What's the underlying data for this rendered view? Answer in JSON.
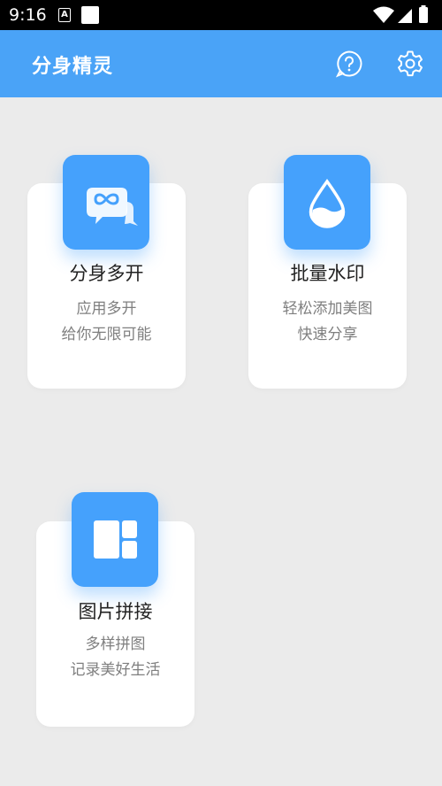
{
  "status_bar": {
    "time": "9:16",
    "notification_letter": "A"
  },
  "app_bar": {
    "title": "分身精灵"
  },
  "cards": [
    {
      "title": "分身多开",
      "desc_line1": "应用多开",
      "desc_line2": "给你无限可能",
      "icon": "chat-infinity-icon"
    },
    {
      "title": "批量水印",
      "desc_line1": "轻松添加美图",
      "desc_line2": "快速分享",
      "icon": "water-drop-icon"
    },
    {
      "title": "图片拼接",
      "desc_line1": "多样拼图",
      "desc_line2": "记录美好生活",
      "icon": "grid-layout-icon"
    }
  ],
  "colors": {
    "primary": "#4aa3f7",
    "icon_bg": "#45a1fc",
    "background": "#ebebeb"
  }
}
